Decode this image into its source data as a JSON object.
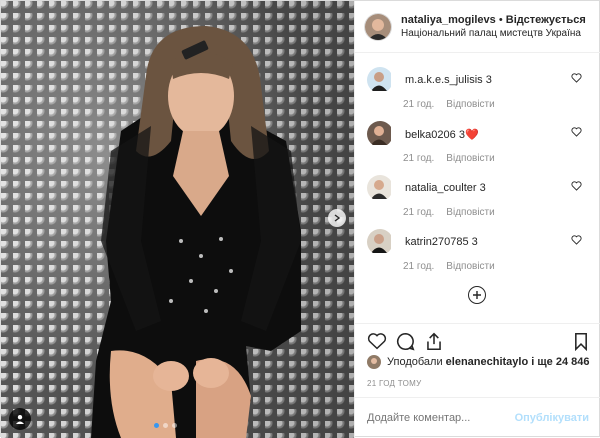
{
  "post": {
    "username": "nataliya_mogilevs",
    "separator": "•",
    "follow_state": "Відстежується",
    "location": "Національний палац мистецтв Україна"
  },
  "comments": [
    {
      "user": "m.a.k.e.s_julisis",
      "text": "3",
      "age": "21 год.",
      "reply": "Відповісти"
    },
    {
      "user": "belka0206",
      "text": "3❤️",
      "age": "21 год.",
      "reply": "Відповісти"
    },
    {
      "user": "natalia_coulter",
      "text": "3",
      "age": "21 год.",
      "reply": "Відповісти"
    },
    {
      "user": "katrin270785",
      "text": "3",
      "age": "21 год.",
      "reply": "Відповісти"
    }
  ],
  "likes": {
    "prefix": "Уподобали",
    "user": "elenanechitaylo",
    "suffix": "і ще 24 846"
  },
  "timestamp": "21 ГОД ТОМУ",
  "composer": {
    "placeholder": "Додайте коментар...",
    "submit": "Опублікувати"
  },
  "carousel": {
    "count": 3,
    "active_index": 0
  },
  "colors": {
    "accent": "#3897f0",
    "muted": "#8e8e8e",
    "text": "#262626"
  }
}
